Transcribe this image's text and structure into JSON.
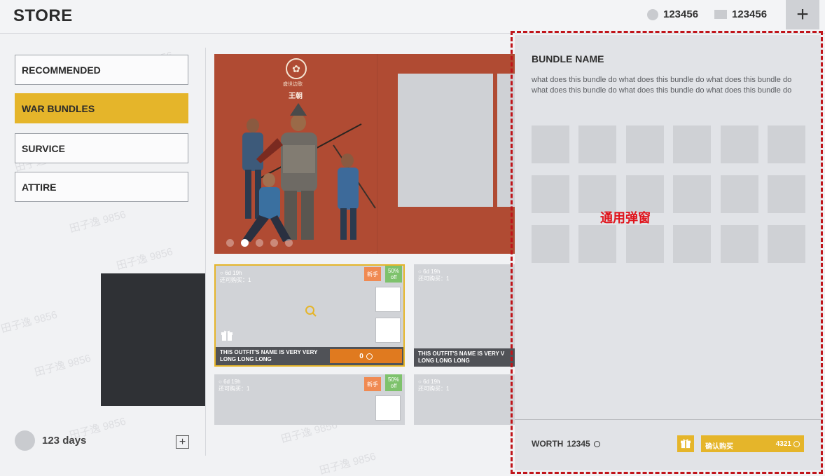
{
  "header": {
    "title": "STORE",
    "currency1": {
      "icon": "coin-icon",
      "value": "123456"
    },
    "currency2": {
      "icon": "gem-icon",
      "value": "123456"
    },
    "plus_label": "+"
  },
  "sidebar": {
    "items": [
      {
        "label": "RECOMMENDED",
        "active": false
      },
      {
        "label": "WAR BUNDLES",
        "active": true
      },
      {
        "label": "SURVICE",
        "active": false
      },
      {
        "label": "ATTIRE",
        "active": false
      }
    ],
    "user_days": "123 days"
  },
  "banner": {
    "subtitle": "盛世边歌",
    "name": "王朝",
    "dot_count": 5,
    "active_dot": 1
  },
  "cards": [
    {
      "timer": "6d 19h",
      "remaining": "还可购买：1",
      "tag_new": "新手",
      "tag_off": "50% off",
      "name": "THIS OUTFIT'S NAME IS VERY VERY LONG LONG LONG",
      "price": "0"
    },
    {
      "timer": "6d 19h",
      "remaining": "还可购买：1",
      "name": "THIS OUTFIT'S NAME IS VERY V",
      "name2": "LONG LONG LONG"
    },
    {
      "timer": "6d 19h",
      "remaining": "还可购买：1",
      "tag_new": "新手",
      "tag_off": "50% off"
    },
    {
      "timer": "6d 19h",
      "remaining": "还可购买：1"
    }
  ],
  "popup": {
    "bundle_name": "BUNDLE NAME",
    "description": "what does this bundle do what does this bundle do what does this bundle do what does this bundle do what does this bundle do what does this bundle do",
    "item_slots": 18,
    "overlay_label": "通用弹窗",
    "worth_label": "WORTH",
    "worth_value": "12345",
    "buy_label": "确认购买",
    "buy_price": "4321"
  },
  "watermark": "田子逸 9856",
  "colors": {
    "accent": "#e5b52a",
    "price_orange": "#e07a1f",
    "banner_red": "#b04b33",
    "annotation_red": "#c0141a",
    "tag_new": "#f08a52",
    "tag_off": "#7ec26c"
  }
}
